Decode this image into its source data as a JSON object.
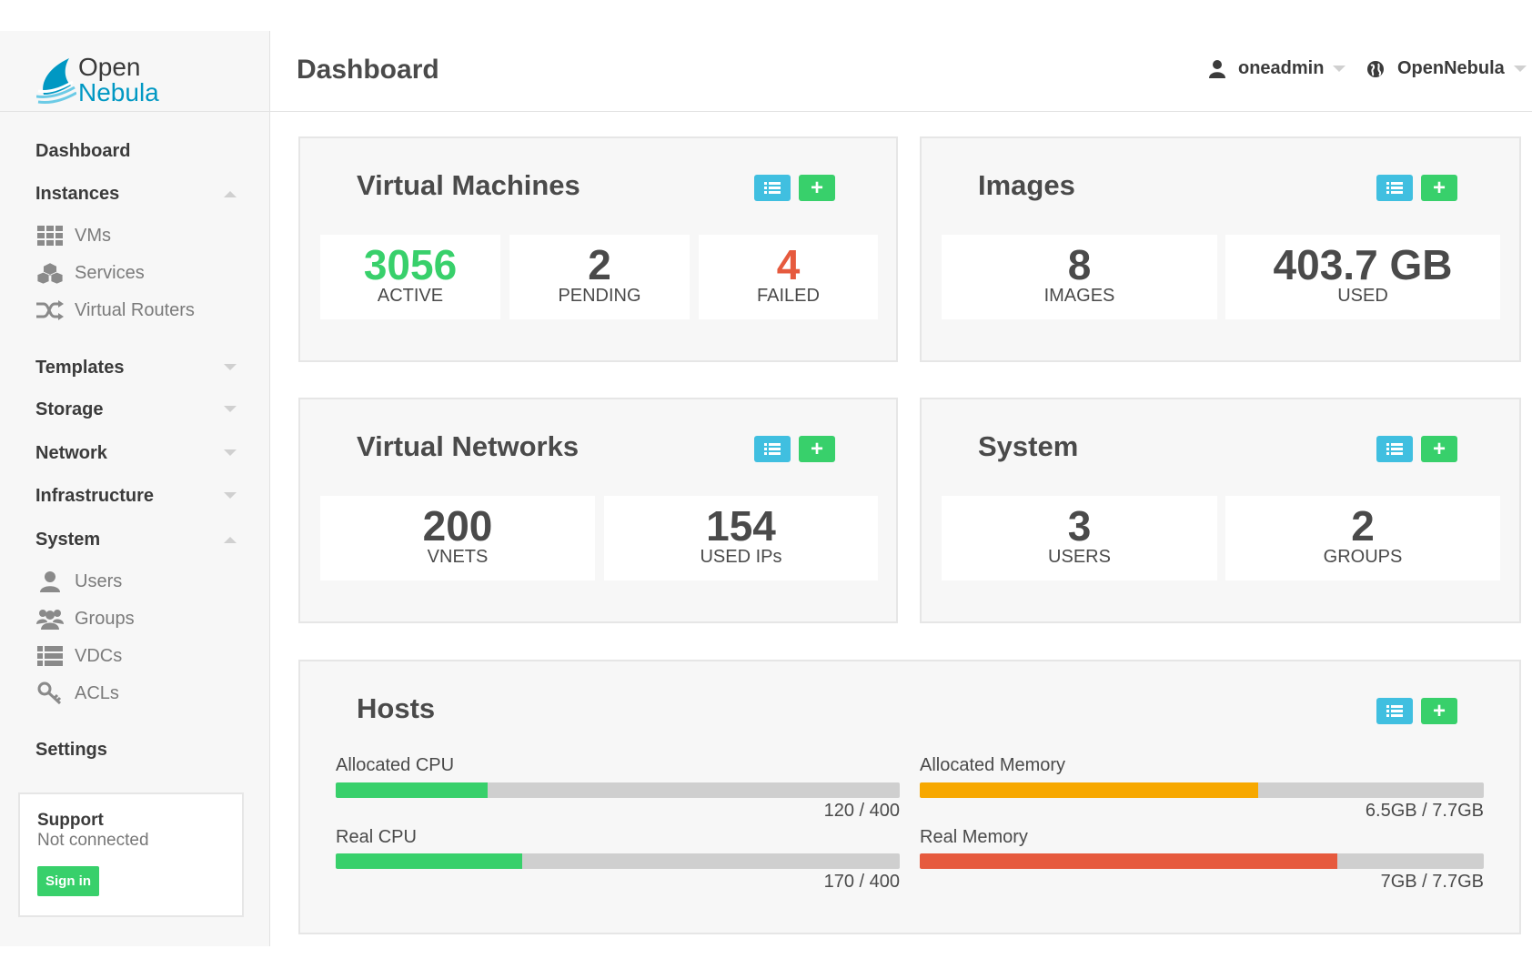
{
  "brand": {
    "line1": "Open",
    "line2": "Nebula",
    "logo_icon": "opennebula-logo-icon"
  },
  "header": {
    "title": "Dashboard",
    "user": {
      "label": "oneadmin",
      "icon": "user-icon"
    },
    "zone": {
      "label": "OpenNebula",
      "icon": "globe-icon"
    }
  },
  "sidebar": {
    "dashboard": "Dashboard",
    "instances": {
      "label": "Instances",
      "items": [
        {
          "label": "VMs",
          "icon": "grid-icon"
        },
        {
          "label": "Services",
          "icon": "cubes-icon"
        },
        {
          "label": "Virtual Routers",
          "icon": "random-icon"
        }
      ]
    },
    "templates": "Templates",
    "storage": "Storage",
    "network": "Network",
    "infrastructure": "Infrastructure",
    "system": {
      "label": "System",
      "items": [
        {
          "label": "Users",
          "icon": "user-icon"
        },
        {
          "label": "Groups",
          "icon": "users-icon"
        },
        {
          "label": "VDCs",
          "icon": "list-icon"
        },
        {
          "label": "ACLs",
          "icon": "key-icon"
        }
      ]
    },
    "settings": "Settings",
    "support": {
      "title": "Support",
      "status": "Not connected",
      "signin": "Sign in"
    }
  },
  "panels": {
    "vms": {
      "title": "Virtual Machines",
      "stats": [
        {
          "value": "3056",
          "label": "ACTIVE",
          "color": "#38d06b"
        },
        {
          "value": "2",
          "label": "PENDING"
        },
        {
          "value": "4",
          "label": "FAILED",
          "color": "#e65a3e"
        }
      ]
    },
    "images": {
      "title": "Images",
      "stats": [
        {
          "value": "8",
          "label": "IMAGES"
        },
        {
          "value": "403.7 GB",
          "label": "USED"
        }
      ]
    },
    "vnets": {
      "title": "Virtual Networks",
      "stats": [
        {
          "value": "200",
          "label": "VNETS"
        },
        {
          "value": "154",
          "label": "USED IPs"
        }
      ]
    },
    "system": {
      "title": "System",
      "stats": [
        {
          "value": "3",
          "label": "USERS"
        },
        {
          "value": "2",
          "label": "GROUPS"
        }
      ]
    },
    "hosts": {
      "title": "Hosts",
      "bars": {
        "allocated_cpu": {
          "label": "Allocated CPU",
          "value": "120 / 400",
          "fraction": 0.27,
          "color": "#38d06b"
        },
        "real_cpu": {
          "label": "Real CPU",
          "value": "170 / 400",
          "fraction": 0.33,
          "color": "#38d06b"
        },
        "allocated_memory": {
          "label": "Allocated Memory",
          "value": "6.5GB / 7.7GB",
          "fraction": 0.6,
          "color": "#f7a800"
        },
        "real_memory": {
          "label": "Real Memory",
          "value": "7GB / 7.7GB",
          "fraction": 0.74,
          "color": "#e65a3e"
        }
      }
    }
  },
  "colors": {
    "accent_blue": "#40bfe0",
    "accent_green": "#38d06b",
    "brand_blue": "#0098c3"
  }
}
